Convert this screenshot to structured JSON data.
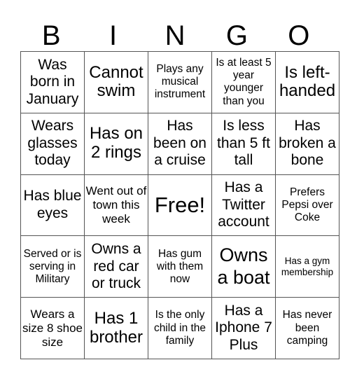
{
  "title_letters": [
    "B",
    "I",
    "N",
    "G",
    "O"
  ],
  "rows": [
    [
      "Was born in January",
      "Cannot swim",
      "Plays any musical instrument",
      "Is at least 5 year younger than you",
      "Is left-handed"
    ],
    [
      "Wears glasses today",
      "Has on 2 rings",
      "Has been on a cruise",
      "Is less than 5 ft tall",
      "Has broken a bone"
    ],
    [
      "Has blue eyes",
      "Went out of town this week",
      "Free!",
      "Has a Twitter account",
      "Prefers Pepsi over Coke"
    ],
    [
      "Served or is serving in Military",
      "Owns a red car or truck",
      "Has gum with them now",
      "Owns a boat",
      "Has a gym membership"
    ],
    [
      "Wears a size 8 shoe size",
      "Has 1 brother",
      "Is the only child in the family",
      "Has a Iphone 7 Plus",
      "Has never been camping"
    ]
  ]
}
